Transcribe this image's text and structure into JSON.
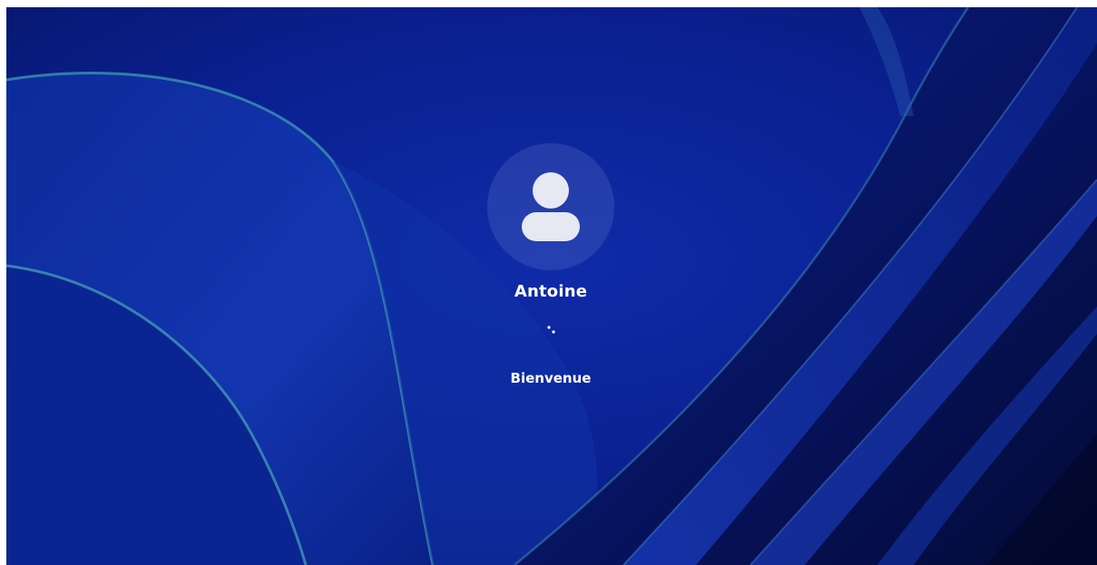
{
  "login": {
    "username": "Antoine",
    "status": "Bienvenue"
  },
  "icons": {
    "avatar": "user-silhouette-icon",
    "progress": "loading-dots-icon"
  },
  "colors": {
    "wallpaper_base": "#0a1f8e",
    "wallpaper_deep": "#06114f",
    "accent_teal": "#4aa7b8",
    "avatar_glyph": "#e6e8f2",
    "text": "#ffffff"
  }
}
